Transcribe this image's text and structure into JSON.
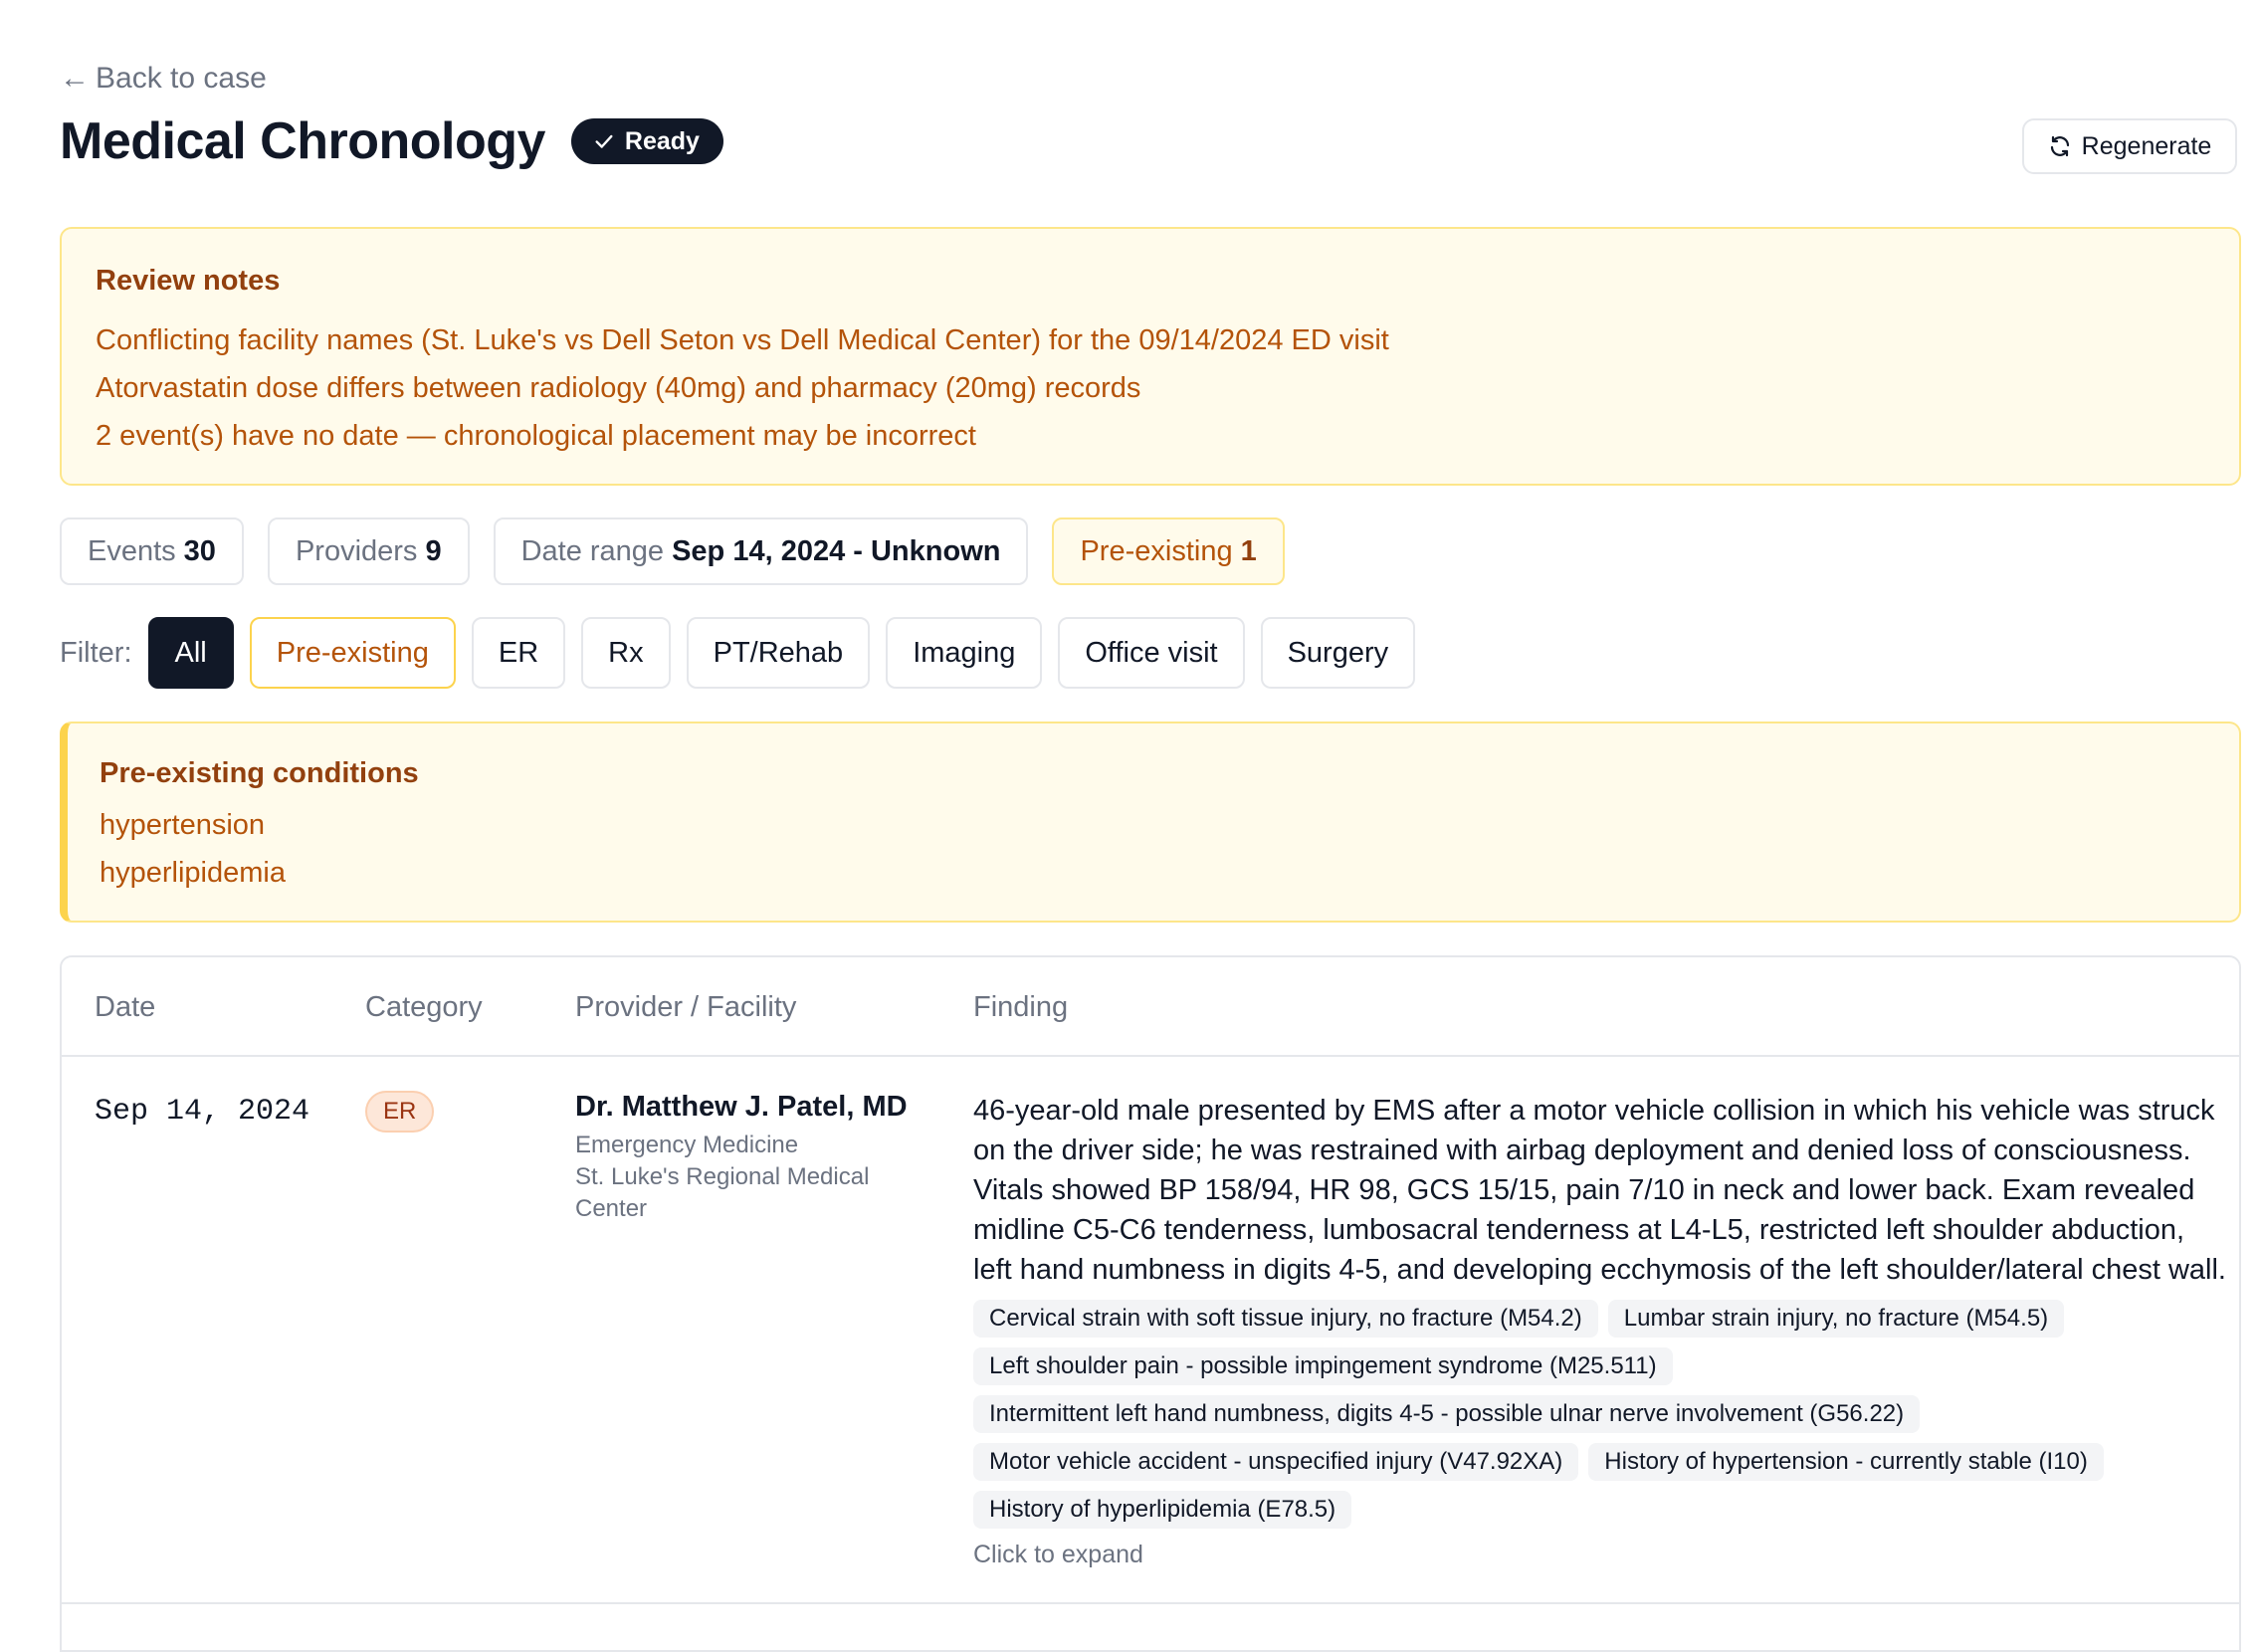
{
  "back_link": "Back to case",
  "title": "Medical Chronology",
  "status_badge": "Ready",
  "regenerate_label": "Regenerate",
  "review": {
    "heading": "Review notes",
    "notes": [
      "Conflicting facility names (St. Luke's vs Dell Seton vs Dell Medical Center) for the 09/14/2024 ED visit",
      "Atorvastatin dose differs between radiology (40mg) and pharmacy (20mg) records",
      "2 event(s) have no date — chronological placement may be incorrect"
    ]
  },
  "stats": {
    "events_label": "Events",
    "events_value": "30",
    "providers_label": "Providers",
    "providers_value": "9",
    "range_label": "Date range",
    "range_value": "Sep 14, 2024 - Unknown",
    "pre_label": "Pre-existing",
    "pre_value": "1"
  },
  "filter": {
    "label": "Filter:",
    "options": [
      "All",
      "Pre-existing",
      "ER",
      "Rx",
      "PT/Rehab",
      "Imaging",
      "Office visit",
      "Surgery"
    ],
    "selected": "All"
  },
  "pre_existing": {
    "heading": "Pre-existing conditions",
    "conditions": [
      "hypertension",
      "hyperlipidemia"
    ]
  },
  "table": {
    "columns": [
      "Date",
      "Category",
      "Provider / Facility",
      "Finding"
    ],
    "rows": [
      {
        "date": "Sep 14, 2024",
        "category": "ER",
        "provider": "Dr. Matthew J. Patel, MD",
        "specialty": "Emergency Medicine",
        "facility": "St. Luke's Regional Medical Center",
        "finding": "46-year-old male presented by EMS after a motor vehicle collision in which his vehicle was struck on the driver side; he was restrained with airbag deployment and denied loss of consciousness. Vitals showed BP 158/94, HR 98, GCS 15/15, pain 7/10 in neck and lower back. Exam revealed midline C5-C6 tenderness, lumbosacral tenderness at L4-L5, restricted left shoulder abduction, left hand numbness in digits 4-5, and developing ecchymosis of the left shoulder/lateral chest wall.",
        "diagnoses": [
          "Cervical strain with soft tissue injury, no fracture (M54.2)",
          "Lumbar strain injury, no fracture (M54.5)",
          "Left shoulder pain - possible impingement syndrome (M25.511)",
          "Intermittent left hand numbness, digits 4-5 - possible ulnar nerve involvement (G56.22)",
          "Motor vehicle accident - unspecified injury (V47.92XA)",
          "History of hypertension - currently stable (I10)",
          "History of hyperlipidemia (E78.5)"
        ],
        "expand_hint": "Click to expand"
      }
    ]
  }
}
